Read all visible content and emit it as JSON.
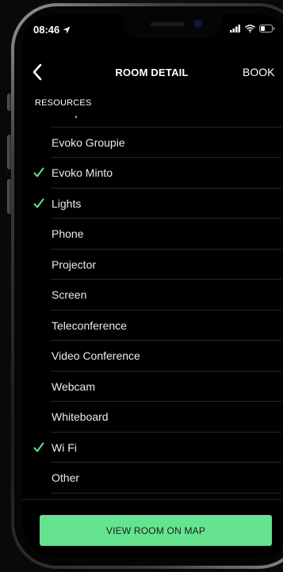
{
  "status_bar": {
    "time": "08:46"
  },
  "nav": {
    "title": "ROOM DETAIL",
    "book_label": "BOOK"
  },
  "section": {
    "header": "RESOURCES"
  },
  "resources": [
    {
      "label": "Computer",
      "checked": false
    },
    {
      "label": "Evoko Groupie",
      "checked": false
    },
    {
      "label": "Evoko Minto",
      "checked": true
    },
    {
      "label": "Lights",
      "checked": true
    },
    {
      "label": "Phone",
      "checked": false
    },
    {
      "label": "Projector",
      "checked": false
    },
    {
      "label": "Screen",
      "checked": false
    },
    {
      "label": "Teleconference",
      "checked": false
    },
    {
      "label": "Video Conference",
      "checked": false
    },
    {
      "label": "Webcam",
      "checked": false
    },
    {
      "label": "Whiteboard",
      "checked": false
    },
    {
      "label": "Wi Fi",
      "checked": true
    },
    {
      "label": "Other",
      "checked": false
    }
  ],
  "footer": {
    "map_button_label": "VIEW ROOM ON MAP"
  },
  "colors": {
    "accent": "#66e38f",
    "check": "#66e38f",
    "background": "#000000"
  },
  "icons": {
    "back": "chevron-left-icon",
    "location": "location-arrow-icon",
    "signal": "cellular-signal-icon",
    "wifi": "wifi-icon",
    "battery": "battery-icon",
    "check": "checkmark-icon"
  }
}
